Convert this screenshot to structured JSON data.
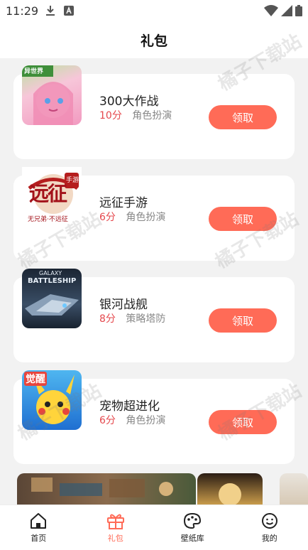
{
  "status": {
    "time": "11:29"
  },
  "header": {
    "title": "礼包"
  },
  "watermark_text": "橘子下载站",
  "gifts": [
    {
      "name": "300大作战",
      "score": "10分",
      "category": "角色扮演",
      "button": "领取",
      "badge": "异世界"
    },
    {
      "name": "远征手游",
      "score": "6分",
      "category": "角色扮演",
      "button": "领取",
      "logo_text": "远征",
      "logo_tag": "手游",
      "slogan": "无兄弟·不远征"
    },
    {
      "name": "银河战舰",
      "score": "8分",
      "category": "策略塔防",
      "button": "领取",
      "logo_title": "GALAXY",
      "logo_sub": "BATTLESHIP"
    },
    {
      "name": "宠物超进化",
      "score": "6分",
      "category": "角色扮演",
      "button": "领取",
      "badge": "觉醒"
    }
  ],
  "tabs": [
    {
      "label": "首页",
      "icon": "home-icon"
    },
    {
      "label": "礼包",
      "icon": "gift-icon",
      "active": true
    },
    {
      "label": "壁纸库",
      "icon": "palette-icon"
    },
    {
      "label": "我的",
      "icon": "smiley-icon"
    }
  ],
  "colors": {
    "accent": "#ff6b57",
    "score": "#e5484d"
  }
}
